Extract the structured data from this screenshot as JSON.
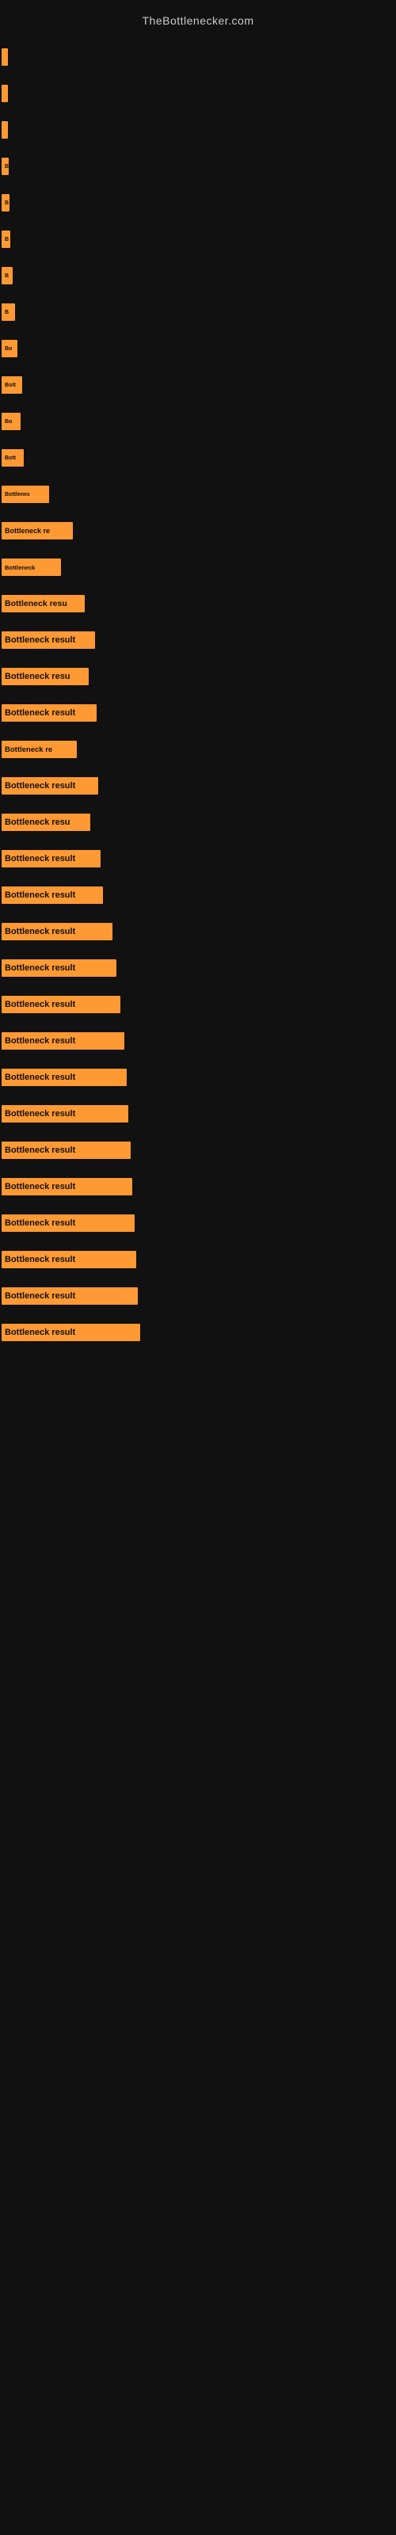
{
  "site": {
    "title": "TheBottlenecker.com"
  },
  "chart": {
    "background": "#111111",
    "bar_color": "#ff9933",
    "text_color": "#cccccc"
  },
  "bars": [
    {
      "label": "",
      "width": 4
    },
    {
      "label": "",
      "width": 6
    },
    {
      "label": "",
      "width": 7
    },
    {
      "label": "B",
      "width": 9
    },
    {
      "label": "B",
      "width": 10
    },
    {
      "label": "B",
      "width": 11
    },
    {
      "label": "B",
      "width": 14
    },
    {
      "label": "B",
      "width": 17
    },
    {
      "label": "Bo",
      "width": 20
    },
    {
      "label": "Bott",
      "width": 26
    },
    {
      "label": "Bo",
      "width": 24
    },
    {
      "label": "Bott",
      "width": 28
    },
    {
      "label": "Bottlenec",
      "width": 60
    },
    {
      "label": "Bottleneck re",
      "width": 90
    },
    {
      "label": "Bottleneck",
      "width": 75
    },
    {
      "label": "Bottleneck resu",
      "width": 105
    },
    {
      "label": "Bottleneck result",
      "width": 118
    },
    {
      "label": "Bottleneck resu",
      "width": 110
    },
    {
      "label": "Bottleneck result",
      "width": 120
    },
    {
      "label": "Bottleneck re",
      "width": 95
    },
    {
      "label": "Bottleneck result",
      "width": 122
    },
    {
      "label": "Bottleneck resu",
      "width": 112
    },
    {
      "label": "Bottleneck result",
      "width": 125
    },
    {
      "label": "Bottleneck result",
      "width": 128
    },
    {
      "label": "Bottleneck result",
      "width": 140
    },
    {
      "label": "Bottleneck result",
      "width": 145
    },
    {
      "label": "Bottleneck result",
      "width": 150
    },
    {
      "label": "Bottleneck result",
      "width": 155
    },
    {
      "label": "Bottleneck result",
      "width": 158
    },
    {
      "label": "Bottleneck result",
      "width": 160
    },
    {
      "label": "Bottleneck result",
      "width": 163
    },
    {
      "label": "Bottleneck result",
      "width": 165
    },
    {
      "label": "Bottleneck result",
      "width": 168
    },
    {
      "label": "Bottleneck result",
      "width": 170
    },
    {
      "label": "Bottleneck result",
      "width": 172
    },
    {
      "label": "Bottleneck result",
      "width": 175
    }
  ]
}
